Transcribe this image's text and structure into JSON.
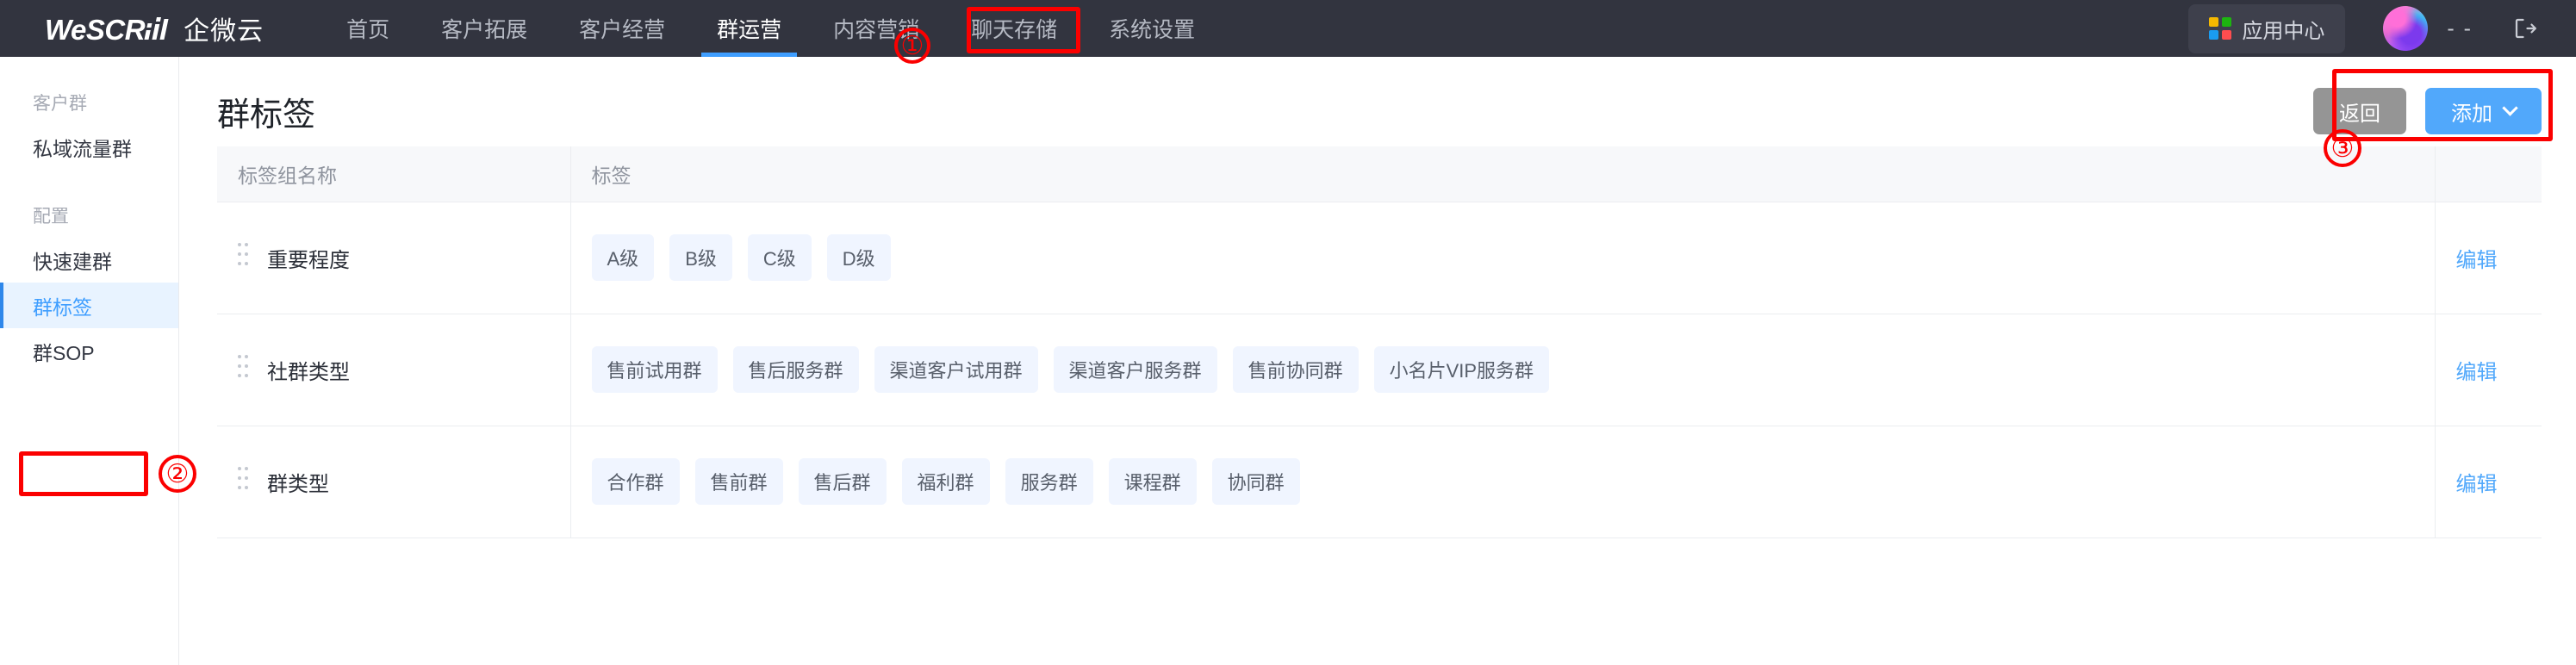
{
  "header": {
    "brand_en": "WeSCR",
    "brand_cn": "企微云",
    "nav": [
      {
        "label": "首页",
        "active": false
      },
      {
        "label": "客户拓展",
        "active": false
      },
      {
        "label": "客户经营",
        "active": false
      },
      {
        "label": "群运营",
        "active": true
      },
      {
        "label": "内容营销",
        "active": false
      },
      {
        "label": "聊天存储",
        "active": false
      },
      {
        "label": "系统设置",
        "active": false
      }
    ],
    "app_center_label": "应用中心",
    "app_center_icon": "grid-apps-icon",
    "app_center_icon_colors": [
      "#f5b800",
      "#1db510",
      "#1a9cf0",
      "#ff4d4f"
    ],
    "avatar_icon": "user-avatar",
    "user_name": "- -",
    "logout_icon": "logout-icon",
    "bg_color": "#32343f",
    "active_underline_color": "#3f9eff"
  },
  "sidebar": {
    "groups": [
      {
        "title": "客户群",
        "items": [
          {
            "label": "私域流量群",
            "active": false
          }
        ]
      },
      {
        "title": "配置",
        "items": [
          {
            "label": "快速建群",
            "active": false
          },
          {
            "label": "群标签",
            "active": true
          },
          {
            "label": "群SOP",
            "active": false
          }
        ]
      }
    ],
    "active_color": "#3f9eff",
    "active_bg": "#e8f3ff"
  },
  "main": {
    "page_title": "群标签",
    "back_button": "返回",
    "add_button": "添加",
    "add_button_icon": "chevron-down-icon",
    "primary_color": "#51a8fb",
    "table": {
      "columns": [
        "标签组名称",
        "标签",
        ""
      ],
      "rows": [
        {
          "group_name": "重要程度",
          "tags": [
            "A级",
            "B级",
            "C级",
            "D级"
          ],
          "action": "编辑"
        },
        {
          "group_name": "社群类型",
          "tags": [
            "售前试用群",
            "售后服务群",
            "渠道客户试用群",
            "渠道客户服务群",
            "售前协同群",
            "小名片VIP服务群"
          ],
          "action": "编辑"
        },
        {
          "group_name": "群类型",
          "tags": [
            "合作群",
            "售前群",
            "售后群",
            "福利群",
            "服务群",
            "课程群",
            "协同群"
          ],
          "action": "编辑"
        }
      ]
    }
  },
  "annotations": {
    "color": "#fb0000",
    "markers": [
      {
        "label": "①",
        "target": "群运营"
      },
      {
        "label": "②",
        "target": "群标签"
      },
      {
        "label": "③",
        "target": "添加"
      }
    ]
  }
}
